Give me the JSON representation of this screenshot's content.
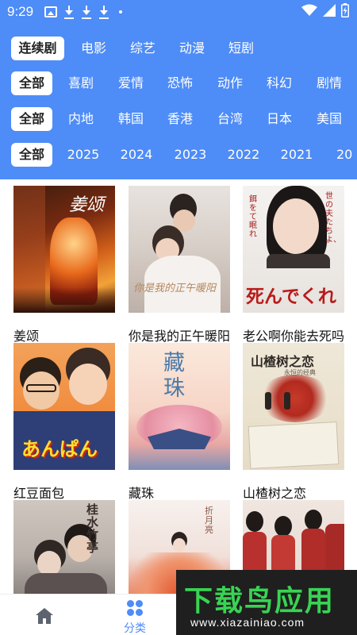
{
  "status_bar": {
    "time": "9:29",
    "left_icons": [
      "image-icon",
      "download-icon",
      "download-icon",
      "download-icon",
      "dot-icon"
    ],
    "right_icons": [
      "wifi-icon",
      "signal-icon",
      "battery-charging-icon"
    ]
  },
  "filters": {
    "type_tabs": [
      "连续剧",
      "电影",
      "综艺",
      "动漫",
      "短剧"
    ],
    "genre_tabs": [
      "全部",
      "喜剧",
      "爱情",
      "恐怖",
      "动作",
      "科幻",
      "剧情"
    ],
    "region_tabs": [
      "全部",
      "内地",
      "韩国",
      "香港",
      "台湾",
      "日本",
      "美国"
    ],
    "year_tabs": [
      "全部",
      "2025",
      "2024",
      "2023",
      "2022",
      "2021",
      "20"
    ]
  },
  "grid": {
    "items": [
      {
        "title": "姜颂",
        "poster_text": "姜颂"
      },
      {
        "title": "你是我的正午暖阳",
        "poster_text": "你是我的正午暖阳"
      },
      {
        "title": "老公啊你能去死吗",
        "poster_text": "死んでくれ",
        "poster_text_2": "世の夫たちよ、",
        "poster_text_3": "餌をて眠れ"
      },
      {
        "title": "红豆面包",
        "poster_text": "あんぱん"
      },
      {
        "title": "藏珠",
        "poster_text": "藏珠"
      },
      {
        "title": "山楂树之恋",
        "poster_text": "山楂树之恋",
        "poster_subtext": "永恒的经典"
      },
      {
        "title": "",
        "poster_text": "桂水竹亭"
      },
      {
        "title": "",
        "poster_text": "折月亮"
      },
      {
        "title": "",
        "poster_text": ""
      }
    ]
  },
  "bottom_nav": {
    "home_icon": "home-icon",
    "category_icon": "grid-icon",
    "category_label": "分类"
  },
  "watermark": {
    "logo": "下载鸟应用",
    "url": "www.xiazainiao.com"
  },
  "colors": {
    "header": "#4e8cf7",
    "active_chip": "#ffffff",
    "watermark_green": "#39d353"
  }
}
